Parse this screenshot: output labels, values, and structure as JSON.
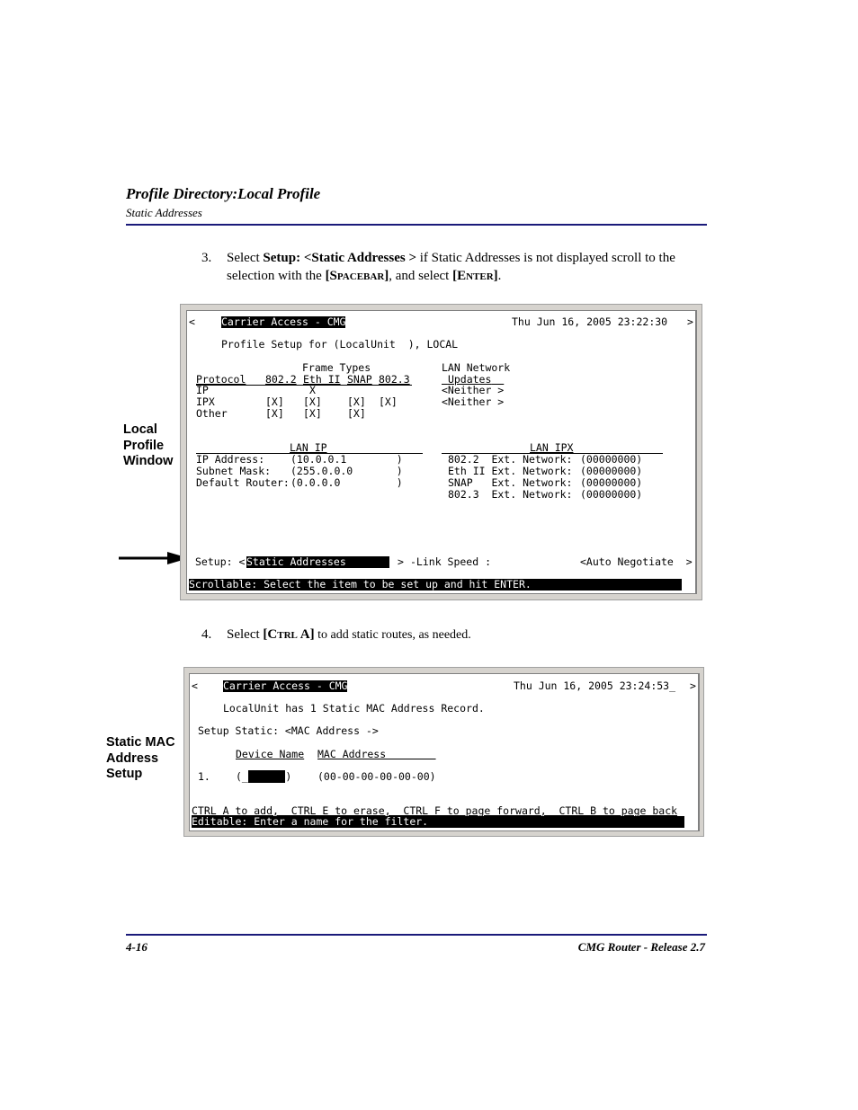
{
  "header": {
    "title": "Profile Directory:Local Profile",
    "subtitle": "Static Addresses"
  },
  "steps": [
    {
      "number": "3.",
      "parts": {
        "a": "Select ",
        "b": "Setup: <Static Addresses >",
        "c": " if Static Addresses is not displayed scroll to the selection with the ",
        "d": "[S",
        "e": "pacebar",
        "f": "]",
        "g": ", and select ",
        "h": "[E",
        "i": "nter",
        "j": "]",
        "k": "."
      }
    },
    {
      "number": "4.",
      "parts": {
        "a": "Select ",
        "b": "[C",
        "c": "trl",
        "d": " A]",
        "e": " to add static routes, as needed."
      }
    }
  ],
  "callouts": {
    "local_profile": [
      "Local",
      "Profile",
      "Window"
    ],
    "static_mac": [
      "Static MAC",
      "Address",
      "Setup"
    ]
  },
  "screen1": {
    "left_arrow": "<",
    "right_arrow": ">",
    "title": "Carrier Access - CMG",
    "datetime": "Thu Jun 16, 2005 23:22:30",
    "profile_line": "Profile Setup for (LocalUnit  ), LOCAL",
    "frame_types_label": "Frame Types",
    "lan_network_label": "LAN Network",
    "updates_label": "Updates",
    "columns": [
      "Protocol",
      "802.2",
      "Eth II",
      "SNAP",
      "802.3"
    ],
    "rows": [
      {
        "protocol": "IP",
        "c8022": "",
        "ethii": "X",
        "snap": "",
        "c8023": "",
        "updates": "<Neither >"
      },
      {
        "protocol": "IPX",
        "c8022": "[X]",
        "ethii": "[X]",
        "snap": "[X]",
        "c8023": "[X]",
        "updates": "<Neither >"
      },
      {
        "protocol": "Other",
        "c8022": "[X]",
        "ethii": "[X]",
        "snap": "[X]",
        "c8023": "",
        "updates": ""
      }
    ],
    "lan_ip": {
      "heading": "LAN IP",
      "fields": [
        {
          "label": "IP Address:",
          "value": "(10.0.0.1        )"
        },
        {
          "label": "Subnet Mask:",
          "value": "(255.0.0.0       )"
        },
        {
          "label": "Default Router:",
          "value": "(0.0.0.0         )"
        }
      ]
    },
    "lan_ipx": {
      "heading": "LAN IPX",
      "fields": [
        {
          "label": "802.2  Ext. Network:",
          "value": "(00000000)"
        },
        {
          "label": "Eth II Ext. Network:",
          "value": "(00000000)"
        },
        {
          "label": "SNAP   Ext. Network:",
          "value": "(00000000)"
        },
        {
          "label": "802.3  Ext. Network:",
          "value": "(00000000)"
        }
      ]
    },
    "setup_label": "Setup: <",
    "setup_value": "Static Addresses       ",
    "setup_close": ">",
    "link_speed_label": "-Link Speed :",
    "link_speed_value": "<Auto Negotiate  >",
    "status": "Scrollable: Select the item to be set up and hit ENTER."
  },
  "screen2": {
    "left_arrow": "<",
    "right_arrow": ">",
    "title": "Carrier Access - CMG",
    "datetime": "Thu Jun 16, 2005 23:24:53_",
    "record_line": "LocalUnit has 1 Static MAC Address Record.",
    "setup_line": "Setup Static: <MAC Address ->",
    "col_device": "Device Name",
    "col_mac": "MAC Address        ",
    "row": {
      "index": "1.",
      "name_open": "(_",
      "name_close": ")",
      "mac": "(00-00-00-00-00-00)"
    },
    "help": "CTRL A to add,  CTRL E to erase,  CTRL F to page forward,  CTRL B to page back",
    "status": "Editable: Enter a name for the filter."
  },
  "footer": {
    "page": "4-16",
    "doc": "CMG Router - Release 2.7"
  }
}
